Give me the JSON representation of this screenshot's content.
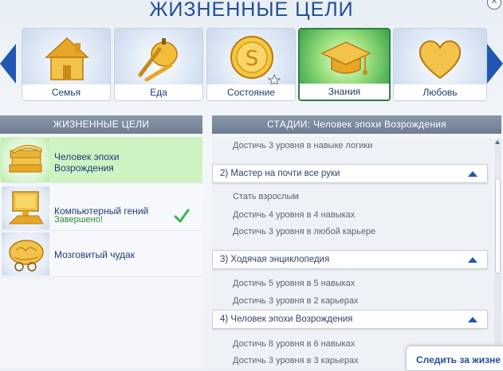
{
  "header": {
    "title": "ЖИЗНЕННЫЕ ЦЕЛИ",
    "close_icon": "close-icon"
  },
  "nav": {
    "left_arrow_icon": "arrow-left-icon",
    "right_arrow_icon": "arrow-right-icon"
  },
  "categories": [
    {
      "label": "Семья",
      "icon": "house-icon",
      "active": false
    },
    {
      "label": "Еда",
      "icon": "food-icon",
      "active": false
    },
    {
      "label": "Состояние",
      "icon": "coin-icon",
      "active": false
    },
    {
      "label": "Знания",
      "icon": "graduation-cap-icon",
      "active": true
    },
    {
      "label": "Любовь",
      "icon": "heart-icon",
      "active": false
    }
  ],
  "left_panel": {
    "header": "ЖИЗНЕННЫЕ ЦЕЛИ",
    "goals": [
      {
        "name": "Человек эпохи Возрождения",
        "status": "",
        "icon": "books-icon",
        "selected": true
      },
      {
        "name": "Компьютерный гений",
        "status": "Завершено!",
        "icon": "computer-icon",
        "selected": false,
        "completed": true
      },
      {
        "name": "Мозговитый чудак",
        "status": "",
        "icon": "brain-icon",
        "selected": false
      }
    ]
  },
  "right_panel": {
    "header": "СТАДИИ: Человек эпохи Возрождения",
    "step_0": "Достичь 3 уровня в навыке логики",
    "stage_2": "2) Мастер на почти все руки",
    "step_2a": "Стать взрослым",
    "step_2b": "Достичь 4 уровня в 4 навыках",
    "step_2c": "Достичь 3 уровня в любой карьере",
    "stage_3": "3) Ходячая энциклопедия",
    "step_3a": "Достичь 5 уровня в 5 навыках",
    "step_3b": "Достичь 3 уровня в 2 карьерах",
    "stage_4": "4) Человек эпохи Возрождения",
    "step_4a": "Достичь 8 уровня в 6 навыках",
    "step_4b": "Достичь 3 уровня в 3 карьерах"
  },
  "footer": {
    "follow_button": "Следить за жизне"
  },
  "colors": {
    "accent": "#1f4e97",
    "active_tab": "#3aa348",
    "selected_row": "#cdf3c2",
    "complete": "#2e8b3a"
  }
}
